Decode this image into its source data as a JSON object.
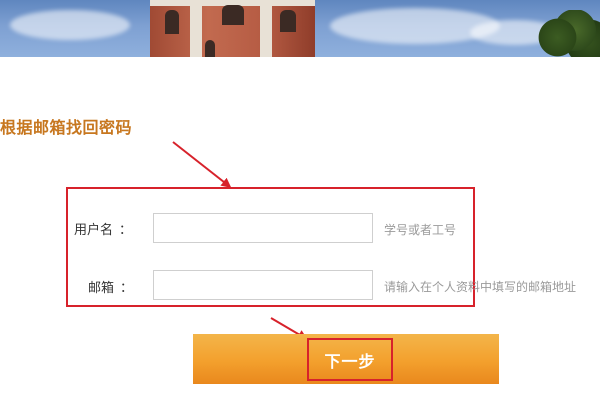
{
  "page": {
    "title": "根据邮箱找回密码"
  },
  "form": {
    "username": {
      "label": "用户名",
      "colon": "：",
      "value": "",
      "placeholder": "",
      "hint": "学号或者工号"
    },
    "email": {
      "label": "邮箱",
      "colon": "：",
      "value": "",
      "placeholder": "",
      "hint": "请输入在个人资料中填写的邮箱地址"
    }
  },
  "actions": {
    "next_label": "下一步"
  },
  "colors": {
    "title": "#c7771f",
    "highlight_red": "#d7222b",
    "button_orange": "#f3a02d",
    "hint_gray": "#9a9a9a"
  }
}
